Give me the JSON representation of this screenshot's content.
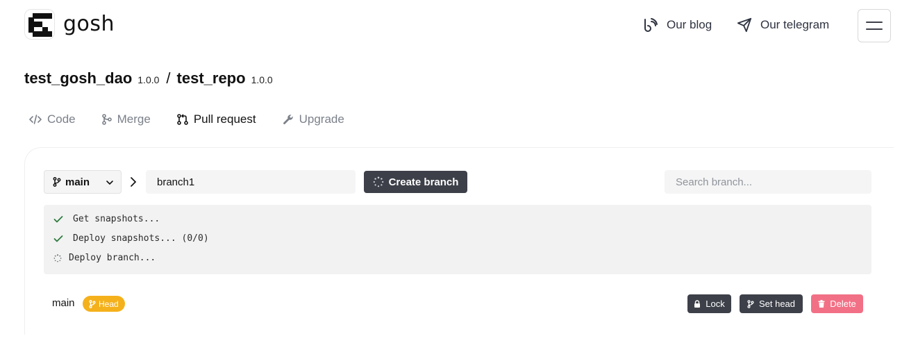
{
  "header": {
    "logo_text": "gosh",
    "blog_label": "Our blog",
    "telegram_label": "Our telegram"
  },
  "title": {
    "dao_name": "test_gosh_dao",
    "dao_version": "1.0.0",
    "separator": "/",
    "repo_name": "test_repo",
    "repo_version": "1.0.0"
  },
  "tabs": [
    {
      "label": "Code",
      "icon": "code-icon",
      "active": false
    },
    {
      "label": "Merge",
      "icon": "merge-icon",
      "active": false
    },
    {
      "label": "Pull request",
      "icon": "pull-request-icon",
      "active": true
    },
    {
      "label": "Upgrade",
      "icon": "wrench-icon",
      "active": false
    }
  ],
  "branch_form": {
    "from_branch": "main",
    "new_branch_value": "branch1",
    "create_label": "Create branch",
    "search_placeholder": "Search branch..."
  },
  "log": [
    {
      "status": "done",
      "text": "Get snapshots..."
    },
    {
      "status": "done",
      "text": "Deploy snapshots... (0/0)"
    },
    {
      "status": "pending",
      "text": "Deploy branch..."
    }
  ],
  "branches": [
    {
      "name": "main",
      "badge": "Head",
      "actions": {
        "lock": "Lock",
        "set_head": "Set head",
        "delete": "Delete"
      }
    }
  ],
  "colors": {
    "dark_button": "#3d4049",
    "head_badge": "#f5b11b",
    "delete_button": "#f27085",
    "log_background": "#f1f2f1",
    "check": "#2f7a3f"
  }
}
